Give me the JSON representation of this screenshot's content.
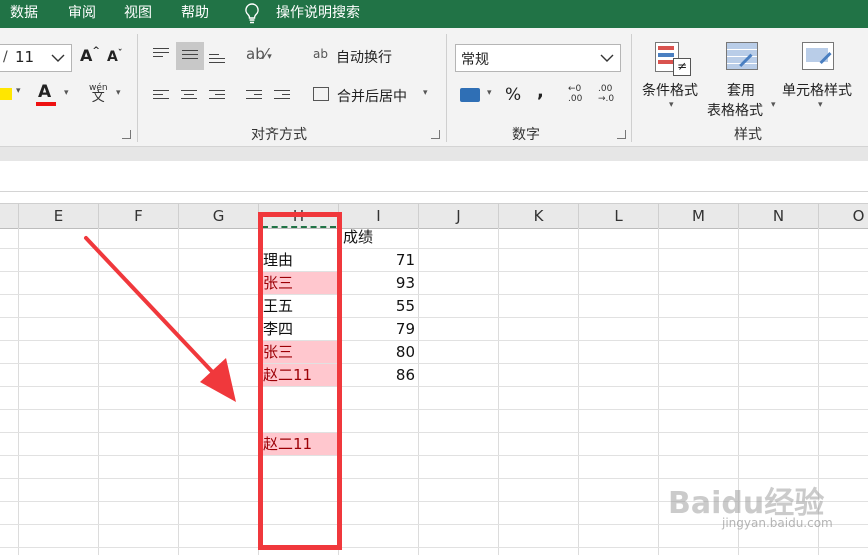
{
  "menu": [
    "数据",
    "审阅",
    "视图",
    "帮助"
  ],
  "tell_me": {
    "icon": "lightbulb-icon",
    "label": "操作说明搜索"
  },
  "font": {
    "size": "11"
  },
  "alignment": {
    "wrap_text": "自动换行",
    "merge_center": "合并后居中",
    "group_label": "对齐方式"
  },
  "number": {
    "format": "常规",
    "percent": "%",
    "comma": ",",
    "group_label": "数字"
  },
  "styles": {
    "conditional_line1": "条件格式",
    "table_line1": "套用",
    "table_line2": "表格格式",
    "cell_styles": "单元格样式",
    "group_label": "样式"
  },
  "columns": [
    "E",
    "F",
    "G",
    "H",
    "I",
    "J",
    "K",
    "L",
    "M",
    "N",
    "O"
  ],
  "rows": [
    {
      "h": "",
      "i": "成绩",
      "dup": false
    },
    {
      "h": "理由",
      "i": "71",
      "dup": false
    },
    {
      "h": "张三",
      "i": "93",
      "dup": true
    },
    {
      "h": "王五",
      "i": "55",
      "dup": false
    },
    {
      "h": "李四",
      "i": "79",
      "dup": false
    },
    {
      "h": "张三",
      "i": "80",
      "dup": true
    },
    {
      "h": "赵二11",
      "i": "86",
      "dup": true
    },
    {
      "h": "",
      "i": "",
      "dup": false
    },
    {
      "h": "",
      "i": "",
      "dup": false
    },
    {
      "h": "赵二11",
      "i": "",
      "dup": true
    }
  ],
  "colors": {
    "accent": "#217346",
    "highlight_fill": "#ffc7ce",
    "highlight_text": "#9c0006",
    "annotation": "#f0383c"
  },
  "watermark": {
    "brand": "Baidu经验",
    "url": "jingyan.baidu.com"
  }
}
